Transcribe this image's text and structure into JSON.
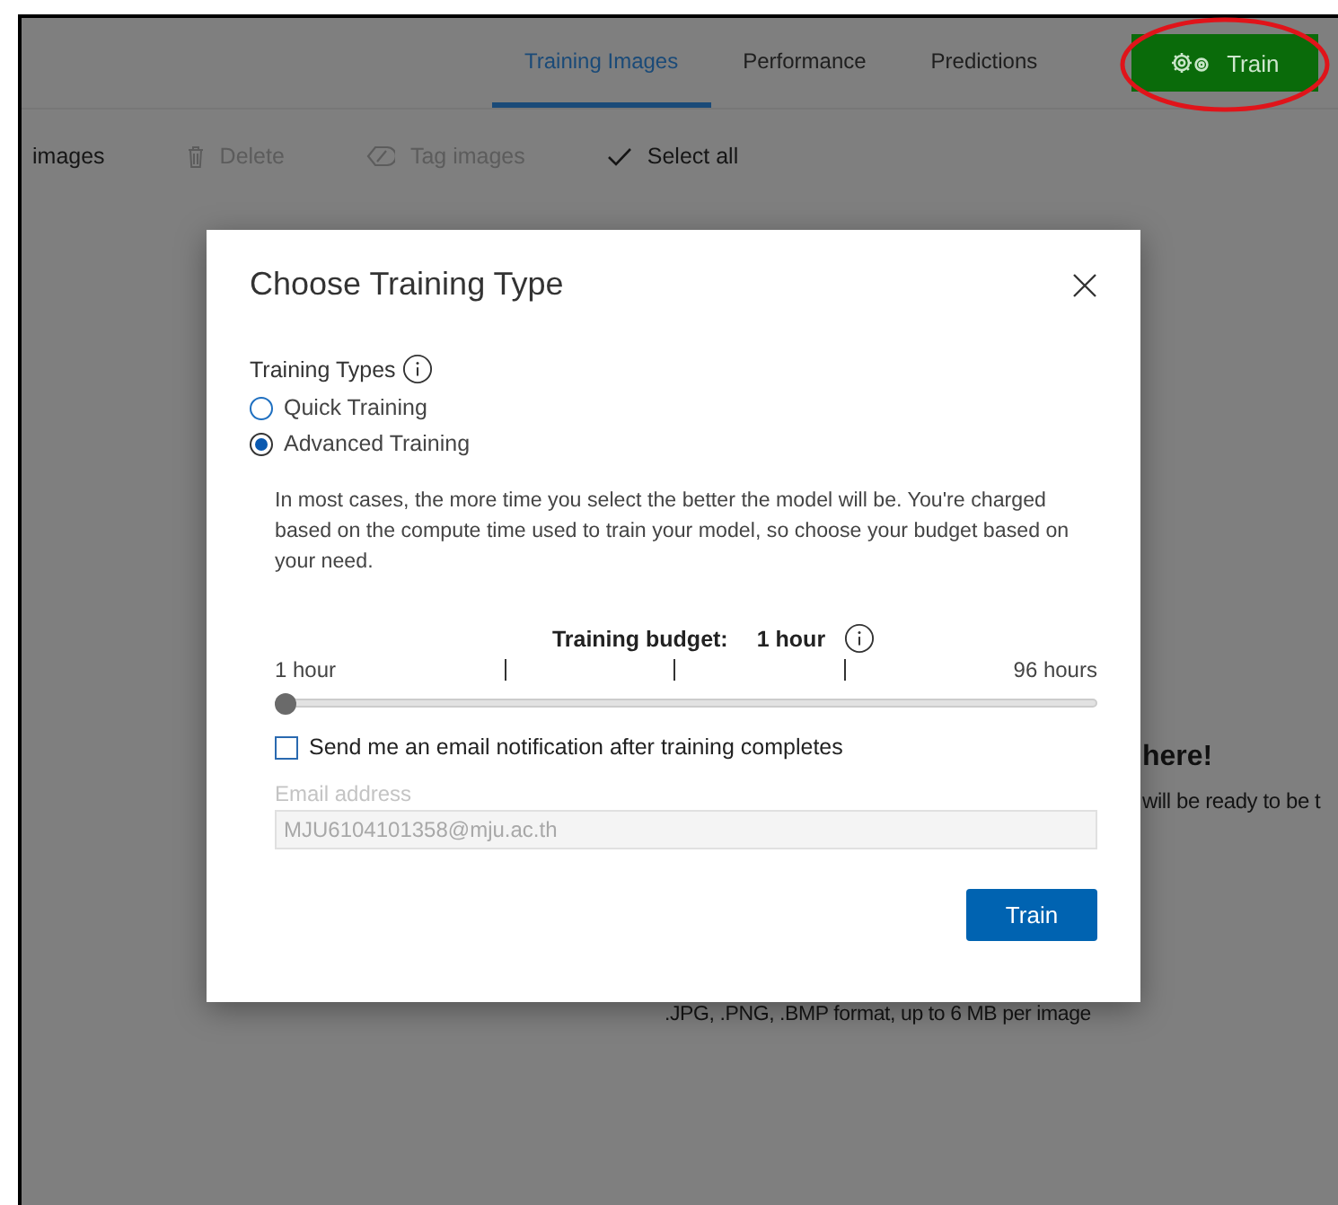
{
  "nav": {
    "tabs": [
      {
        "label": "Training Images",
        "selected": true
      },
      {
        "label": "Performance",
        "selected": false
      },
      {
        "label": "Predictions",
        "selected": false
      }
    ],
    "train_button": "Train"
  },
  "toolbar": [
    {
      "kind": "plain",
      "label": "images",
      "disabled": false
    },
    {
      "kind": "trash",
      "label": "Delete",
      "disabled": true
    },
    {
      "kind": "tag",
      "label": "Tag images",
      "disabled": true
    },
    {
      "kind": "check",
      "label": "Select all",
      "disabled": false
    }
  ],
  "background": {
    "heading": "here!",
    "text": "will be ready to be t",
    "formats": ".JPG, .PNG, .BMP format, up to 6 MB per image"
  },
  "dialog": {
    "title": "Choose Training Type",
    "types_label": "Training Types",
    "options": [
      {
        "label": "Quick Training",
        "selected": false
      },
      {
        "label": "Advanced Training",
        "selected": true
      }
    ],
    "description": "In most cases, the more time you select the better the model will be. You're charged based on the compute time used to train your model, so choose your budget based on your need.",
    "budget": {
      "label": "Training budget:",
      "value": "1 hour",
      "min_label": "1 hour",
      "max_label": "96 hours",
      "level": 0
    },
    "notify": {
      "label": "Send me an email notification after training completes",
      "checked": false
    },
    "email": {
      "label": "Email address",
      "value": "MJU6104101358@mju.ac.th",
      "disabled": true
    },
    "submit": "Train"
  }
}
